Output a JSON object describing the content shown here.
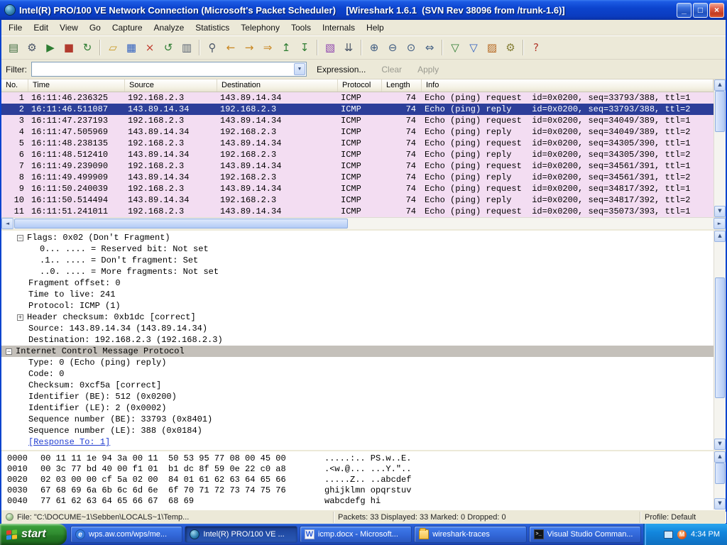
{
  "colors": {
    "icmp_row_bg": "#f3ddf2",
    "selected_row_bg": "#2c3e99",
    "details_selected_bg": "#c4c0ba",
    "titlebar_blue": "#0c44ce",
    "taskbar_blue": "#2456cc",
    "start_green": "#2f8a2f"
  },
  "window": {
    "title": "Intel(R) PRO/100 VE Network Connection (Microsoft's Packet Scheduler)    [Wireshark 1.6.1  (SVN Rev 38096 from /trunk-1.6)]"
  },
  "menu": {
    "items": [
      "File",
      "Edit",
      "View",
      "Go",
      "Capture",
      "Analyze",
      "Statistics",
      "Telephony",
      "Tools",
      "Internals",
      "Help"
    ]
  },
  "toolbar": {
    "buttons": [
      {
        "name": "list-interfaces-icon",
        "glyph": "▤",
        "color": "#3d6b3d"
      },
      {
        "name": "capture-options-icon",
        "glyph": "⚙",
        "color": "#4a5568"
      },
      {
        "name": "start-capture-icon",
        "glyph": "▶",
        "color": "#2e7d32"
      },
      {
        "name": "stop-capture-icon",
        "glyph": "■",
        "color": "#b23b2e"
      },
      {
        "name": "restart-capture-icon",
        "glyph": "↻",
        "color": "#2e7d32"
      },
      {
        "separator": true
      },
      {
        "name": "open-capture-icon",
        "glyph": "▱",
        "color": "#c9971f"
      },
      {
        "name": "save-capture-icon",
        "glyph": "▦",
        "color": "#2f5fbf"
      },
      {
        "name": "close-capture-icon",
        "glyph": "×",
        "color": "#c0392b"
      },
      {
        "name": "reload-icon",
        "glyph": "↺",
        "color": "#2e7d32"
      },
      {
        "name": "print-icon",
        "glyph": "▥",
        "color": "#5a6472"
      },
      {
        "separator": true
      },
      {
        "name": "find-packet-icon",
        "glyph": "⚲",
        "color": "#4a5568"
      },
      {
        "name": "go-back-icon",
        "glyph": "←",
        "color": "#c9861f"
      },
      {
        "name": "go-forward-icon",
        "glyph": "→",
        "color": "#c9861f"
      },
      {
        "name": "go-to-packet-icon",
        "glyph": "⇒",
        "color": "#c9861f"
      },
      {
        "name": "go-first-icon",
        "glyph": "↥",
        "color": "#2e7d32"
      },
      {
        "name": "go-last-icon",
        "glyph": "↧",
        "color": "#2e7d32"
      },
      {
        "separator": true
      },
      {
        "name": "colorize-list-icon",
        "glyph": "▧",
        "color": "#8e44ad"
      },
      {
        "name": "auto-scroll-icon",
        "glyph": "⇊",
        "color": "#4a5568"
      },
      {
        "separator": true
      },
      {
        "name": "zoom-in-icon",
        "glyph": "⊕",
        "color": "#3d5a80"
      },
      {
        "name": "zoom-out-icon",
        "glyph": "⊖",
        "color": "#3d5a80"
      },
      {
        "name": "zoom-100-icon",
        "glyph": "⊙",
        "color": "#3d5a80"
      },
      {
        "name": "resize-columns-icon",
        "glyph": "⇔",
        "color": "#3d5a80"
      },
      {
        "separator": true
      },
      {
        "name": "capture-filters-icon",
        "glyph": "▽",
        "color": "#2e7d32"
      },
      {
        "name": "display-filters-icon",
        "glyph": "▽",
        "color": "#2f5fbf"
      },
      {
        "name": "coloring-rules-icon",
        "glyph": "▨",
        "color": "#b5651d"
      },
      {
        "name": "preferences-icon",
        "glyph": "⚙",
        "color": "#857f36"
      },
      {
        "separator": true
      },
      {
        "name": "help-icon",
        "glyph": "?",
        "color": "#b23b2e"
      }
    ]
  },
  "filter": {
    "label": "Filter:",
    "value": "",
    "expression": "Expression...",
    "clear": "Clear",
    "apply": "Apply"
  },
  "packet_list": {
    "columns": [
      "No.",
      "Time",
      "Source",
      "Destination",
      "Protocol",
      "Length",
      "Info"
    ],
    "rows": [
      {
        "no": "1",
        "time": "16:11:46.236325",
        "source": "192.168.2.3",
        "destination": "143.89.14.34",
        "protocol": "ICMP",
        "length": "74",
        "info": "Echo (ping) request  id=0x0200, seq=33793/388, ttl=1",
        "selected": false
      },
      {
        "no": "2",
        "time": "16:11:46.511087",
        "source": "143.89.14.34",
        "destination": "192.168.2.3",
        "protocol": "ICMP",
        "length": "74",
        "info": "Echo (ping) reply    id=0x0200, seq=33793/388, ttl=2",
        "selected": true
      },
      {
        "no": "3",
        "time": "16:11:47.237193",
        "source": "192.168.2.3",
        "destination": "143.89.14.34",
        "protocol": "ICMP",
        "length": "74",
        "info": "Echo (ping) request  id=0x0200, seq=34049/389, ttl=1",
        "selected": false
      },
      {
        "no": "4",
        "time": "16:11:47.505969",
        "source": "143.89.14.34",
        "destination": "192.168.2.3",
        "protocol": "ICMP",
        "length": "74",
        "info": "Echo (ping) reply    id=0x0200, seq=34049/389, ttl=2",
        "selected": false
      },
      {
        "no": "5",
        "time": "16:11:48.238135",
        "source": "192.168.2.3",
        "destination": "143.89.14.34",
        "protocol": "ICMP",
        "length": "74",
        "info": "Echo (ping) request  id=0x0200, seq=34305/390, ttl=1",
        "selected": false
      },
      {
        "no": "6",
        "time": "16:11:48.512410",
        "source": "143.89.14.34",
        "destination": "192.168.2.3",
        "protocol": "ICMP",
        "length": "74",
        "info": "Echo (ping) reply    id=0x0200, seq=34305/390, ttl=2",
        "selected": false
      },
      {
        "no": "7",
        "time": "16:11:49.239090",
        "source": "192.168.2.3",
        "destination": "143.89.14.34",
        "protocol": "ICMP",
        "length": "74",
        "info": "Echo (ping) request  id=0x0200, seq=34561/391, ttl=1",
        "selected": false
      },
      {
        "no": "8",
        "time": "16:11:49.499909",
        "source": "143.89.14.34",
        "destination": "192.168.2.3",
        "protocol": "ICMP",
        "length": "74",
        "info": "Echo (ping) reply    id=0x0200, seq=34561/391, ttl=2",
        "selected": false
      },
      {
        "no": "9",
        "time": "16:11:50.240039",
        "source": "192.168.2.3",
        "destination": "143.89.14.34",
        "protocol": "ICMP",
        "length": "74",
        "info": "Echo (ping) request  id=0x0200, seq=34817/392, ttl=1",
        "selected": false
      },
      {
        "no": "10",
        "time": "16:11:50.514494",
        "source": "143.89.14.34",
        "destination": "192.168.2.3",
        "protocol": "ICMP",
        "length": "74",
        "info": "Echo (ping) reply    id=0x0200, seq=34817/392, ttl=2",
        "selected": false
      },
      {
        "no": "11",
        "time": "16:11:51.241011",
        "source": "192.168.2.3",
        "destination": "143.89.14.34",
        "protocol": "ICMP",
        "length": "74",
        "info": "Echo (ping) request  id=0x0200, seq=35073/393, ttl=1",
        "selected": false
      }
    ]
  },
  "details": {
    "lines": [
      {
        "indent": 1,
        "expander": "minus",
        "text": "Flags: 0x02 (Don't Fragment)",
        "selected": false,
        "link": false
      },
      {
        "indent": 2,
        "expander": null,
        "text": "0... .... = Reserved bit: Not set",
        "selected": false,
        "link": false
      },
      {
        "indent": 2,
        "expander": null,
        "text": ".1.. .... = Don't fragment: Set",
        "selected": false,
        "link": false
      },
      {
        "indent": 2,
        "expander": null,
        "text": "..0. .... = More fragments: Not set",
        "selected": false,
        "link": false
      },
      {
        "indent": 1,
        "expander": null,
        "text": "Fragment offset: 0",
        "selected": false,
        "link": false
      },
      {
        "indent": 1,
        "expander": null,
        "text": "Time to live: 241",
        "selected": false,
        "link": false
      },
      {
        "indent": 1,
        "expander": null,
        "text": "Protocol: ICMP (1)",
        "selected": false,
        "link": false
      },
      {
        "indent": 1,
        "expander": "plus",
        "text": "Header checksum: 0xb1dc [correct]",
        "selected": false,
        "link": false
      },
      {
        "indent": 1,
        "expander": null,
        "text": "Source: 143.89.14.34 (143.89.14.34)",
        "selected": false,
        "link": false
      },
      {
        "indent": 1,
        "expander": null,
        "text": "Destination: 192.168.2.3 (192.168.2.3)",
        "selected": false,
        "link": false
      },
      {
        "indent": 0,
        "expander": "minus",
        "text": "Internet Control Message Protocol",
        "selected": true,
        "link": false
      },
      {
        "indent": 1,
        "expander": null,
        "text": "Type: 0 (Echo (ping) reply)",
        "selected": false,
        "link": false
      },
      {
        "indent": 1,
        "expander": null,
        "text": "Code: 0",
        "selected": false,
        "link": false
      },
      {
        "indent": 1,
        "expander": null,
        "text": "Checksum: 0xcf5a [correct]",
        "selected": false,
        "link": false
      },
      {
        "indent": 1,
        "expander": null,
        "text": "Identifier (BE): 512 (0x0200)",
        "selected": false,
        "link": false
      },
      {
        "indent": 1,
        "expander": null,
        "text": "Identifier (LE): 2 (0x0002)",
        "selected": false,
        "link": false
      },
      {
        "indent": 1,
        "expander": null,
        "text": "Sequence number (BE): 33793 (0x8401)",
        "selected": false,
        "link": false
      },
      {
        "indent": 1,
        "expander": null,
        "text": "Sequence number (LE): 388 (0x0184)",
        "selected": false,
        "link": false
      },
      {
        "indent": 1,
        "expander": null,
        "text": "[Response To: 1]",
        "selected": false,
        "link": true
      }
    ]
  },
  "hex": {
    "rows": [
      {
        "offset": "0000",
        "hex": "00 11 11 1e 94 3a 00 11  50 53 95 77 08 00 45 00",
        "ascii": ".....:.. PS.w..E."
      },
      {
        "offset": "0010",
        "hex": "00 3c 77 bd 40 00 f1 01  b1 dc 8f 59 0e 22 c0 a8",
        "ascii": ".<w.@... ...Y.\".."
      },
      {
        "offset": "0020",
        "hex": "02 03 00 00 cf 5a 02 00  84 01 61 62 63 64 65 66",
        "ascii": ".....Z.. ..abcdef"
      },
      {
        "offset": "0030",
        "hex": "67 68 69 6a 6b 6c 6d 6e  6f 70 71 72 73 74 75 76",
        "ascii": "ghijklmn opqrstuv"
      },
      {
        "offset": "0040",
        "hex": "77 61 62 63 64 65 66 67  68 69",
        "ascii": "wabcdefg hi"
      }
    ]
  },
  "statusbar": {
    "file": "File: \"C:\\DOCUME~1\\Sebben\\LOCALS~1\\Temp...",
    "packets": "Packets: 33 Displayed: 33 Marked: 0 Dropped: 0",
    "profile": "Profile: Default"
  },
  "taskbar": {
    "start": "start",
    "items": [
      {
        "label": "wps.aw.com/wps/me...",
        "icon": "ie",
        "active": false
      },
      {
        "label": "Intel(R) PRO/100 VE ...",
        "icon": "wireshark",
        "active": true
      },
      {
        "label": "icmp.docx - Microsoft...",
        "icon": "word",
        "active": false
      },
      {
        "label": "wireshark-traces",
        "icon": "folder",
        "active": false
      },
      {
        "label": "Visual Studio Comman...",
        "icon": "console",
        "active": false
      }
    ],
    "time": "4:34 PM"
  }
}
